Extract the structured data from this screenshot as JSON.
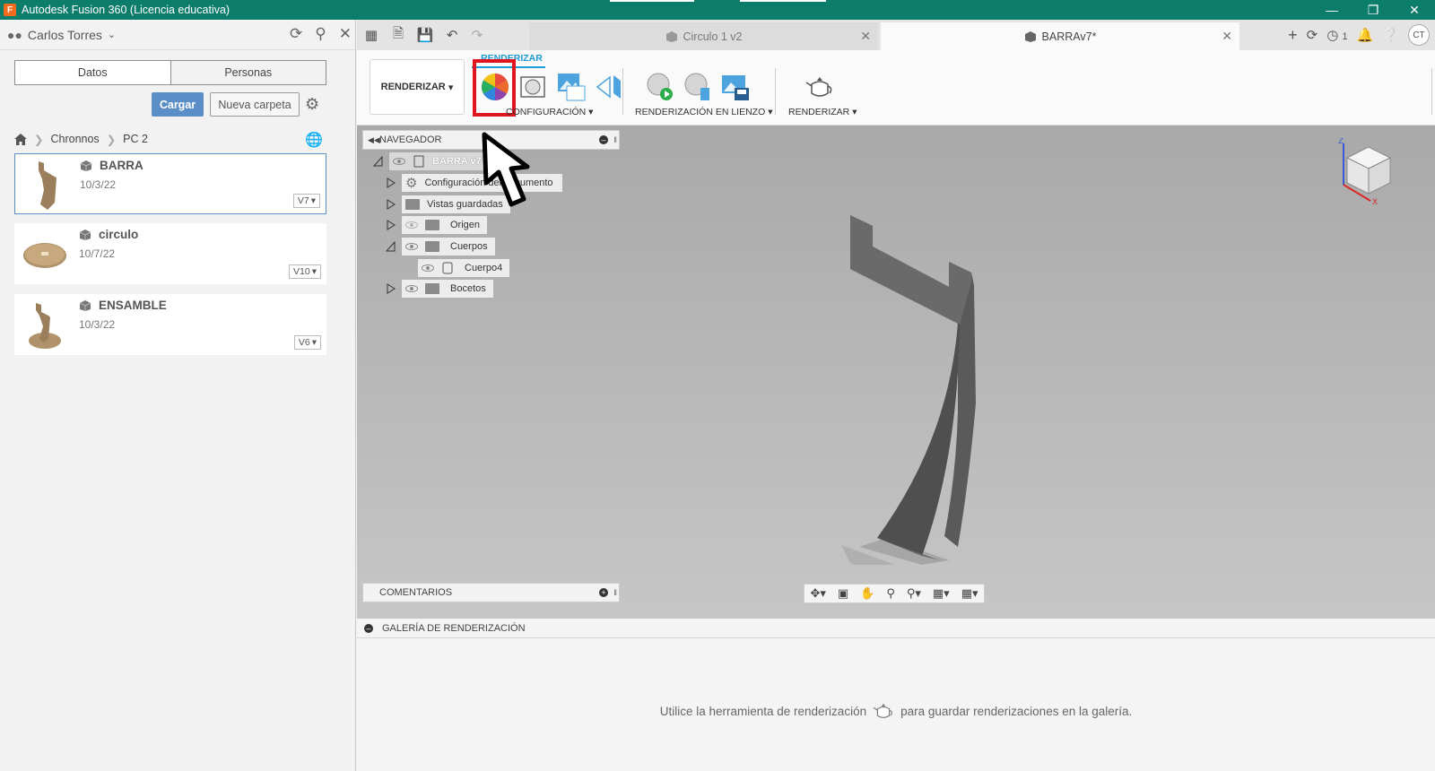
{
  "titlebar": {
    "title": "Autodesk Fusion 360 (Licencia educativa)",
    "app_icon_letter": "F"
  },
  "left_panel": {
    "user_name": "Carlos Torres",
    "tabs": [
      {
        "label": "Datos",
        "active": true
      },
      {
        "label": "Personas",
        "active": false
      }
    ],
    "cargar_label": "Cargar",
    "nueva_carpeta_label": "Nueva carpeta",
    "breadcrumb": [
      "Chronnos",
      "PC 2"
    ],
    "files": [
      {
        "name": "BARRA",
        "date": "10/3/22",
        "version": "V7",
        "selected": true
      },
      {
        "name": "circulo",
        "date": "10/7/22",
        "version": "V10",
        "selected": false
      },
      {
        "name": "ENSAMBLE",
        "date": "10/3/22",
        "version": "V6",
        "selected": false
      }
    ]
  },
  "appbar": {
    "tabs": [
      {
        "label": "Circulo 1 v2",
        "active": false
      },
      {
        "label": "BARRAv7*",
        "active": true
      }
    ],
    "notification_count": "1",
    "avatar_initials": "CT"
  },
  "ribbon": {
    "tab_label": "RENDERIZAR",
    "workspace_label": "RENDERIZAR",
    "groups": [
      {
        "label": "CONFIGURACIÓN"
      },
      {
        "label": "RENDERIZACIÓN EN LIENZO"
      },
      {
        "label": "RENDERIZAR"
      }
    ]
  },
  "navigator": {
    "header": "NAVEGADOR",
    "root": "BARRA v7",
    "items": [
      {
        "label": "Configuración del documento"
      },
      {
        "label": "Vistas guardadas"
      },
      {
        "label": "Origen"
      },
      {
        "label": "Cuerpos"
      },
      {
        "label": "Cuerpo4"
      },
      {
        "label": "Bocetos"
      }
    ]
  },
  "comments": {
    "header": "COMENTARIOS"
  },
  "gallery": {
    "header": "GALERÍA DE RENDERIZACIÓN",
    "message_before": "Utilice la herramienta de renderización",
    "message_after": "para guardar renderizaciones en la galería."
  },
  "viewcube": {
    "axis_z": "Z",
    "axis_x": "X"
  },
  "colors": {
    "titlebar": "#0b7d6a",
    "accent": "#1a9ad6",
    "highlight_box": "#e0141f",
    "primary_button": "#5b8ec7"
  }
}
